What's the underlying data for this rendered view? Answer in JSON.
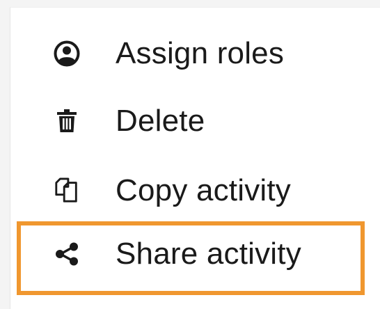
{
  "menu": {
    "items": [
      {
        "id": "assign-roles",
        "label": "Assign roles",
        "icon": "account-circle-icon"
      },
      {
        "id": "delete",
        "label": "Delete",
        "icon": "trash-icon"
      },
      {
        "id": "copy-activity",
        "label": "Copy activity",
        "icon": "copy-icon"
      },
      {
        "id": "share-activity",
        "label": "Share activity",
        "icon": "share-icon"
      }
    ],
    "highlighted_item": "share-activity",
    "highlight_color": "#f0972f",
    "text_color": "#1a1a1a"
  }
}
